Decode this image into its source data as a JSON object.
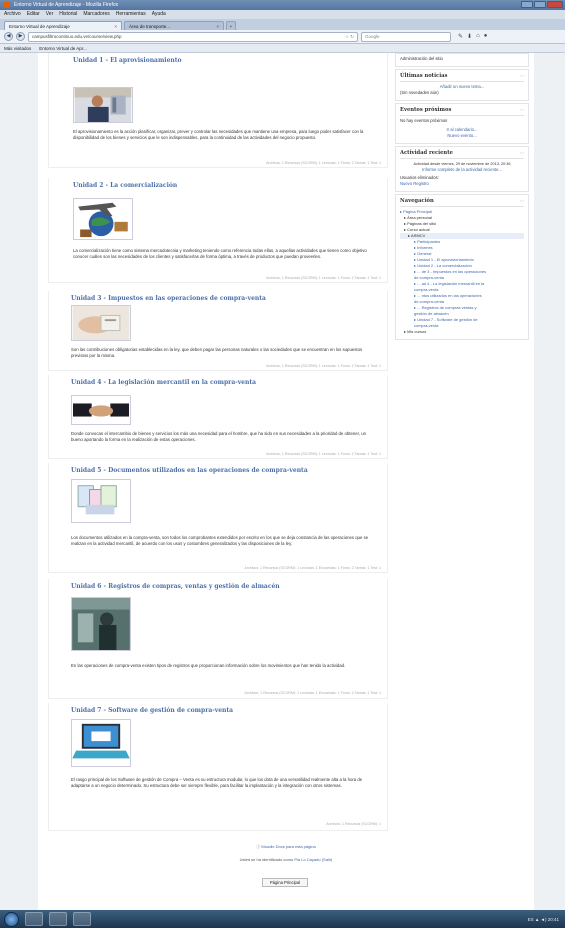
{
  "browser": {
    "title": "Entorno Virtual de Aprendizaje - Mozilla Firefox",
    "menu": [
      "Archivo",
      "Editar",
      "Ver",
      "Historial",
      "Marcadores",
      "Herramientas",
      "Ayuda"
    ],
    "tabs": [
      {
        "label": "Entorno Virtual de Aprendizaje"
      },
      {
        "label": "Área de transporte..."
      }
    ],
    "new_tab": "+",
    "url": "campusfiltrocontinuo.edu.ve/course/view.php",
    "search_placeholder": "Google",
    "bookmarks": [
      "Más visitados",
      "Entorno Virtual de Apr..."
    ]
  },
  "units": [
    {
      "title": "Unidad 1 - El aprovisionamiento",
      "text": "El aprovisionamiento es la acción planificar, organizar, prever y controlar las necesidades que mantiene una empresa, para luego poder satisfacer con la disponibilidad de los bienes y servicios que le son indispensables, para la continuidad de las actividades del negocio propuesto.",
      "foot": "Archivos: 1   Recursos (SCORM): 1   Lecturas: 1   Foros: 2   Tareas: 1   Test: 1"
    },
    {
      "title": "Unidad 2 - La comercialización",
      "text": "La comercialización tiene como sistema mercadotecnia y marketing teniendo como referencia todas ellas, a aquellas actividades que tienen como objetivo conocer cuáles son las necesidades de los clientes y satisfacerlas de forma óptima, a través de productos que puedan proveerles.",
      "foot": "Archivos: 1   Recursos (SCORM): 1   Lecturas: 1   Foros: 2   Tareas: 1   Test: 1"
    },
    {
      "title": "Unidad 3 - Impuestos en las operaciones de compra-venta",
      "text": "Son las contribuciones obligatorias establecidas en la ley, que deben pagar las personas naturales o las sociedades que se encuentran en los supuestos previstos por la misma.",
      "foot": "Archivos: 1   Recursos (SCORM): 1   Lecturas: 1   Foros: 2   Tareas: 1   Test: 1"
    },
    {
      "title": "Unidad 4 - La legislación mercantil en la compra-venta",
      "text": "Donde convocan el intercambio de bienes y servicios los más una necesidad para el hombre, que ha sido en sus necesidades a la prioridad de obtener, un bueno aportando la forma en la realización de estas operaciones.",
      "foot": "Archivos: 1   Recursos (SCORM): 1   Lecturas: 1   Foros: 2   Tareas: 1   Test: 1"
    },
    {
      "title": "Unidad 5 - Documentos utilizados en las operaciones de compra-venta",
      "text": "Los documentos utilizados en la compra-venta, son todos los comprobantes extendidos por escrito en los que se deja constancia de las operaciones que se realizan en la actividad mercantil, de acuerdo con los usos y costumbres generalizados y las disposiciones de la ley.",
      "foot": "Archivos: 1   Recursos (SCORM): 1   Lecturas: 1   Encuestas: 1   Foros: 2   Tareas: 1   Test: 1"
    },
    {
      "title": "Unidad 6 - Registros de compras, ventas y gestión de almacén",
      "text": "En las operaciones de compra-venta existen tipos de registros que proporcionan información sobre los movimientos que han tenido la actividad.",
      "foot": "Archivos: 1   Recursos (SCORM): 1   Lecturas: 1   Encuestas: 1   Foros: 2   Tareas: 1   Test: 1"
    },
    {
      "title": "Unidad 7 - Software de gestión de compra-venta",
      "text": "El rasgo principal de los Software de gestión de Compra – Venta es su estructura modular, lo que los dota de una versatilidad realmente alta a la hora de adaptarse a un negocio determinado. Su estructura debe ser siempre flexible, para facilitar la implantación y la integración con otros sistemas.",
      "foot": "Archivos: 1   Recursos (SCORM): 1"
    }
  ],
  "sidebar": {
    "admin_item": "Administración del sitio",
    "news": {
      "title": "Últimas noticias",
      "link": "Añadir un nuevo tema...",
      "empty": "(Sin novedades aún)"
    },
    "events": {
      "title": "Eventos próximos",
      "empty": "No hay eventos próximos",
      "link1": "Ir al calendario...",
      "link2": "Nuevo evento..."
    },
    "activity": {
      "title": "Actividad reciente",
      "since": "Actividad desde viernes, 29 de noviembre de 2013, 20:36",
      "report": "Informe completo de la actividad reciente...",
      "users_label": "Usuarios eliminados:",
      "users_link": "Nuevo Registro"
    },
    "nav": {
      "title": "Navegación",
      "items": [
        {
          "label": "Página Principal",
          "level": "l0"
        },
        {
          "label": "Área personal",
          "level": "l1"
        },
        {
          "label": "Páginas del sitio",
          "level": "l1"
        },
        {
          "label": "Curso actual",
          "level": "l1"
        },
        {
          "label": "ARMCV",
          "level": "l2"
        },
        {
          "label": "Participantes",
          "level": "l3"
        },
        {
          "label": "Informes",
          "level": "l3"
        },
        {
          "label": "General",
          "level": "l3"
        },
        {
          "label": "Unidad 1 - El aprovisionamiento",
          "level": "l3"
        },
        {
          "label": "Unidad 2 - La comercialización",
          "level": "l3"
        },
        {
          "label": "... de 3 - Impuestos en las operaciones",
          "level": "l3"
        },
        {
          "label": "    de compra-venta",
          "level": "l3"
        },
        {
          "label": "... ad 4 - La legislación mercantil en la",
          "level": "l3"
        },
        {
          "label": "    compra-venta",
          "level": "l3"
        },
        {
          "label": "... ntos utilizados en las operaciones",
          "level": "l3"
        },
        {
          "label": "    de compra-venta",
          "level": "l3"
        },
        {
          "label": "... Registros de compras ventas y",
          "level": "l3"
        },
        {
          "label": "    gestión de almacén",
          "level": "l3"
        },
        {
          "label": "Unidad 7 - Software de gestión de",
          "level": "l3"
        },
        {
          "label": "    compra-venta",
          "level": "l3"
        },
        {
          "label": "Mis cursos",
          "level": "l1"
        }
      ]
    }
  },
  "footer": {
    "docs": "Moodle Docs para esta página",
    "logged_in": "Usted se ha identificado como",
    "user": "Pia Lo Cayado",
    "logout": "(Salir)",
    "home_button": "Página Principal"
  },
  "taskbar": {
    "clock": "ES  ▲  ◄)  20:41"
  }
}
